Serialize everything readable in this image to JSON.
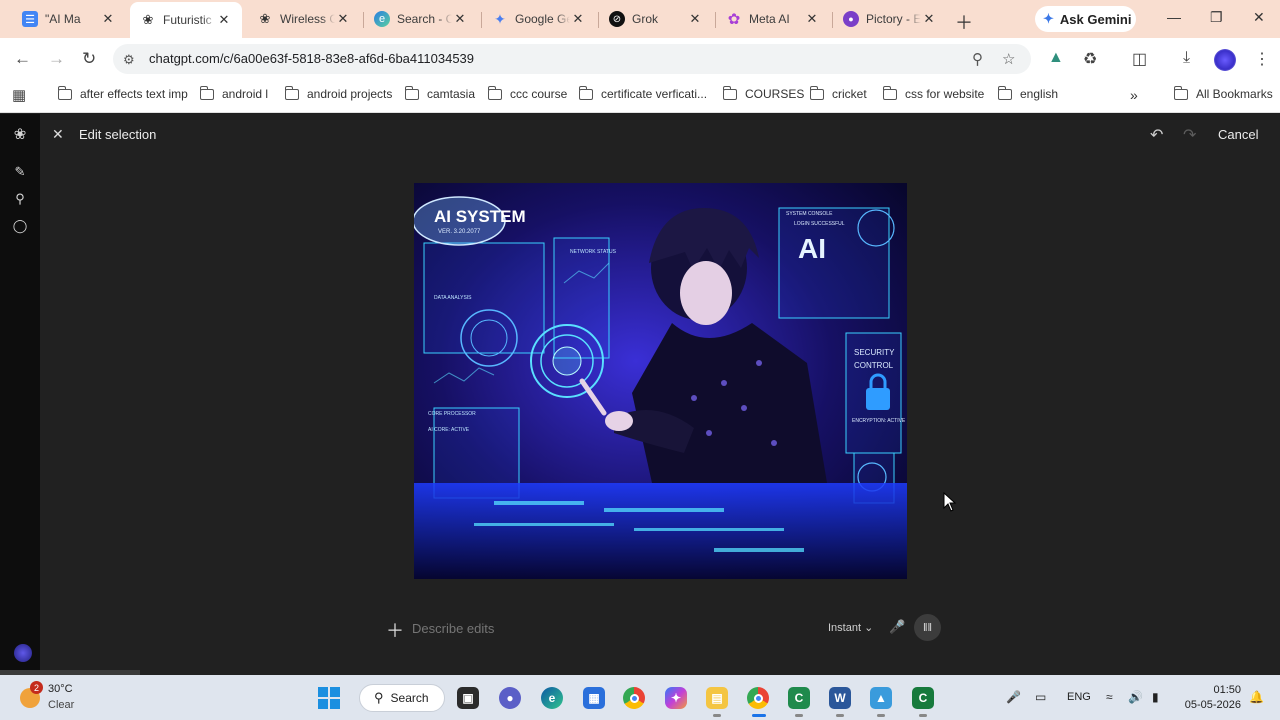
{
  "browser": {
    "tabs": [
      {
        "title": "\"AI Ma",
        "icon": "docs-icon",
        "active": false
      },
      {
        "title": "Futuristic",
        "icon": "openai-icon",
        "active": true
      },
      {
        "title": "Wireless G",
        "icon": "openai-icon",
        "active": false
      },
      {
        "title": "Search - C",
        "icon": "copilot-icon",
        "active": false
      },
      {
        "title": "Google Ge",
        "icon": "gemini-icon",
        "active": false
      },
      {
        "title": "Grok",
        "icon": "grok-icon",
        "active": false
      },
      {
        "title": "Meta AI",
        "icon": "meta-icon",
        "active": false
      },
      {
        "title": "Pictory - E",
        "icon": "pictory-icon",
        "active": false
      }
    ],
    "ask_gemini_label": "Ask Gemini",
    "url": "chatgpt.com/c/6a00e63f-5818-83e8-af6d-6ba411034539",
    "bookmarks": [
      "after effects text imp",
      "android l",
      "android projects",
      "camtasia",
      "ccc course",
      "certificate verficati...",
      "COURSES",
      "cricket",
      "css for website",
      "english"
    ],
    "all_bookmarks_label": "All Bookmarks"
  },
  "editor": {
    "title": "Edit selection",
    "cancel_label": "Cancel",
    "composer_placeholder": "Describe edits",
    "mode_label": "Instant",
    "mode_chevron": "⌄"
  },
  "artwork": {
    "badge_title": "AI SYSTEM",
    "badge_version": "VER. 3.20.2077",
    "data_analysis": "DATA ANALYSIS",
    "network_status": "NETWORK STATUS",
    "system_console": "SYSTEM CONSOLE",
    "login_successful": "LOGIN SUCCESSFUL",
    "ai_label": "AI",
    "security_control_1": "SECURITY",
    "security_control_2": "CONTROL",
    "encryption": "ENCRYPTION: ACTIVE",
    "core_processor": "CORE PROCESSOR",
    "ai_core": "AI CORE: ACTIVE"
  },
  "taskbar": {
    "weather_badge": "2",
    "temperature": "30°C",
    "condition": "Clear",
    "search_label": "Search",
    "language": "ENG",
    "time": "01:50",
    "date": "05-05-2026"
  }
}
